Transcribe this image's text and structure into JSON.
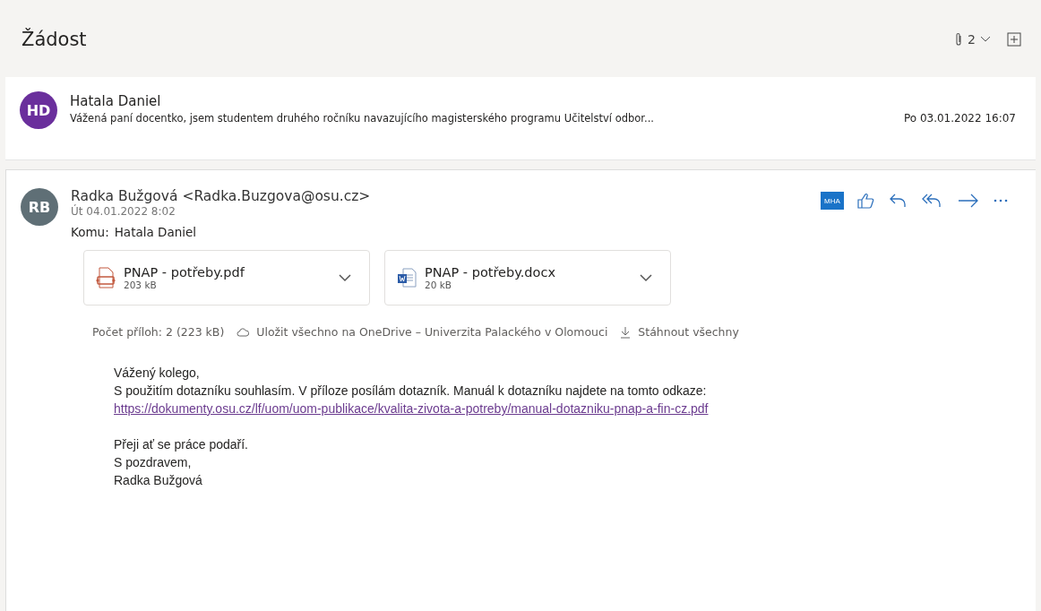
{
  "subject": "Žádost",
  "header_actions": {
    "attachment_count": "2"
  },
  "collapsed_message": {
    "initials": "HD",
    "sender": "Hatala Daniel",
    "preview": "Vážená paní docentko, jsem studentem druhého ročníku navazujícího magisterského programu Učitelství odbor...",
    "date": "Po 03.01.2022 16:07"
  },
  "open_message": {
    "initials": "RB",
    "sender": "Radka Bužgová <Radka.Buzgova@osu.cz>",
    "date": "Út 04.01.2022 8:02",
    "to_label": "Komu:",
    "to": "Hatala Daniel",
    "addin_label": "MHA",
    "attachments": [
      {
        "kind": "pdf",
        "name": "PNAP - potřeby.pdf",
        "size": "203 kB"
      },
      {
        "kind": "docx",
        "name": "PNAP - potřeby.docx",
        "size": "20 kB"
      }
    ],
    "attachment_summary": "Počet příloh: 2 (223 kB)",
    "save_all": "Uložit všechno na OneDrive – Univerzita Palackého v Olomouci",
    "download_all": "Stáhnout všechny",
    "body": [
      {
        "kind": "text",
        "text": "Vážený kolego,"
      },
      {
        "kind": "text",
        "text": "S použitím dotazníku souhlasím. V příloze posílám dotazník. Manuál k dotazníku najdete na tomto odkaze:"
      },
      {
        "kind": "link",
        "text": "https://dokumenty.osu.cz/lf/uom/uom-publikace/kvalita-zivota-a-potreby/manual-dotazniku-pnap-a-fin-cz.pdf"
      },
      {
        "kind": "blank"
      },
      {
        "kind": "text",
        "text": "Přeji ať se práce podaří."
      },
      {
        "kind": "text",
        "text": "S pozdravem,"
      },
      {
        "kind": "text",
        "text": "Radka Bužgová"
      }
    ]
  }
}
